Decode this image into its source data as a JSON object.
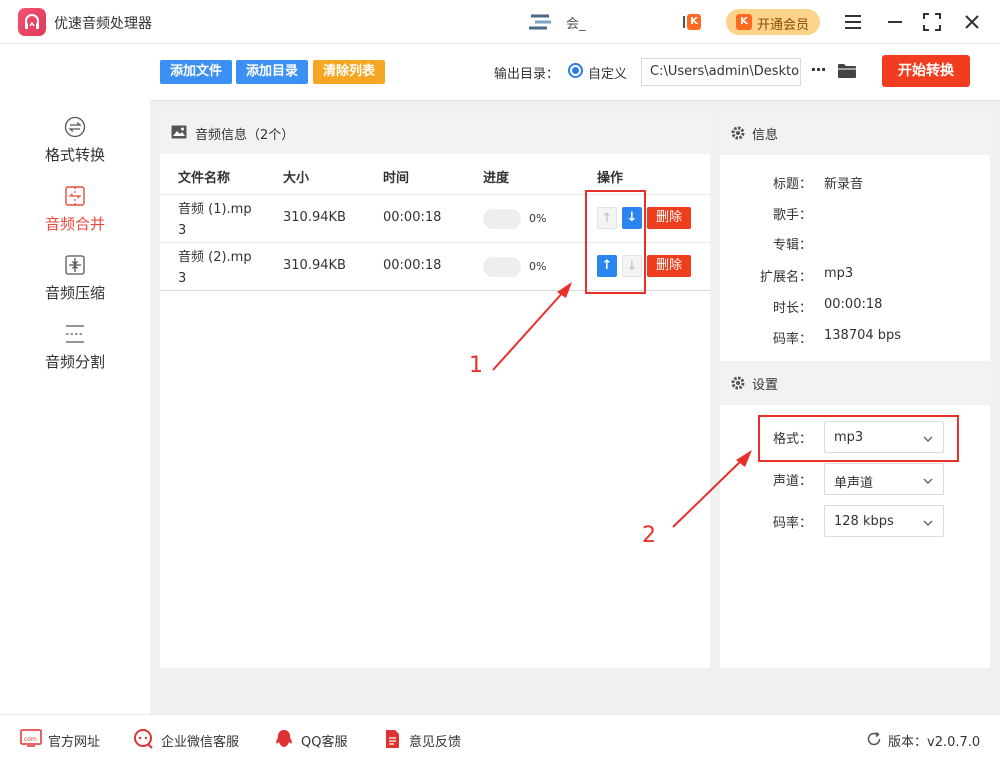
{
  "app": {
    "title": "优速音频处理器"
  },
  "user": {
    "name": "会_"
  },
  "header": {
    "vip_label": "开通会员"
  },
  "toolbar": {
    "add_file": "添加文件",
    "add_dir": "添加目录",
    "clear_list": "清除列表",
    "output_label": "输出目录：",
    "radio_label": "自定义",
    "output_path": "C:\\Users\\admin\\Deskto",
    "more": "···",
    "start": "开始转换"
  },
  "sidebar": {
    "items": [
      {
        "label": "格式转换",
        "icon": "swap-circle-icon",
        "active": false
      },
      {
        "label": "音频合并",
        "icon": "merge-icon",
        "active": true
      },
      {
        "label": "音频压缩",
        "icon": "compress-icon",
        "active": false
      },
      {
        "label": "音频分割",
        "icon": "split-icon",
        "active": false
      }
    ]
  },
  "list": {
    "title": "音频信息（2个）",
    "columns": [
      "文件名称",
      "大小",
      "时间",
      "进度",
      "操作"
    ],
    "rows": [
      {
        "name": "音频 (1).mp3",
        "size": "310.94KB",
        "time": "00:00:18",
        "progress": "0%",
        "up_enabled": false,
        "down_enabled": true
      },
      {
        "name": "音频 (2).mp3",
        "size": "310.94KB",
        "time": "00:00:18",
        "progress": "0%",
        "up_enabled": true,
        "down_enabled": false
      }
    ],
    "delete_label": "删除"
  },
  "info": {
    "title": "信息",
    "fields": [
      {
        "label": "标题：",
        "value": "新录音"
      },
      {
        "label": "歌手：",
        "value": ""
      },
      {
        "label": "专辑：",
        "value": ""
      },
      {
        "label": "扩展名：",
        "value": "mp3"
      },
      {
        "label": "时长：",
        "value": "00:00:18"
      },
      {
        "label": "码率：",
        "value": "138704 bps"
      }
    ]
  },
  "settings": {
    "title": "设置",
    "format_label": "格式：",
    "format_value": "mp3",
    "channel_label": "声道：",
    "channel_value": "单声道",
    "bitrate_label": "码率：",
    "bitrate_value": "128 kbps"
  },
  "annotations": {
    "one": "1",
    "two": "2",
    "color": "#e8302b"
  },
  "footer": {
    "website": "官方网址",
    "wechat": "企业微信客服",
    "qq": "QQ客服",
    "feedback": "意见反馈",
    "version": "版本：v2.0.7.0"
  },
  "colors": {
    "accent_blue": "#3c8ff3",
    "start_red": "#f03d20",
    "active_red": "#e84a3a",
    "clear_orange": "#f5a623"
  }
}
